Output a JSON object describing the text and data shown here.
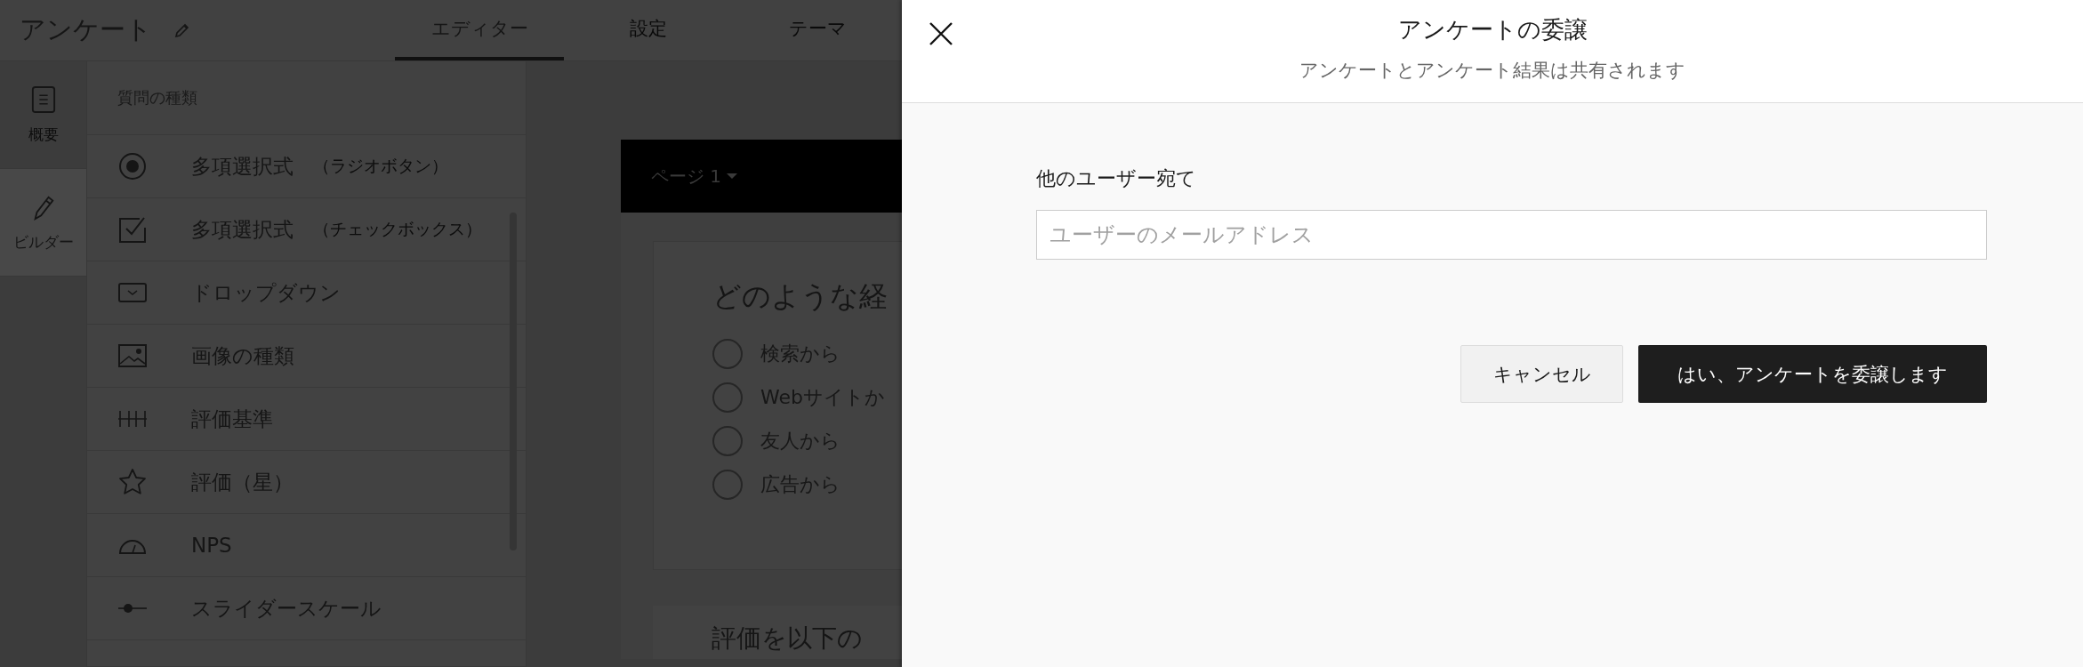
{
  "app_header": {
    "title": "アンケート",
    "tabs": [
      {
        "label": "エディター",
        "selected": true
      },
      {
        "label": "設定",
        "selected": false
      },
      {
        "label": "テーマ",
        "selected": false
      }
    ]
  },
  "side_rail": {
    "items": [
      {
        "kind": "summary",
        "label": "概要",
        "selected": false
      },
      {
        "kind": "builder",
        "label": "ビルダー",
        "selected": true
      }
    ]
  },
  "question_types": {
    "heading": "質問の種類",
    "items": [
      {
        "kind": "radio",
        "label": "多項選択式",
        "note": "（ラジオボタン）"
      },
      {
        "kind": "checkbox",
        "label": "多項選択式",
        "note": "（チェックボックス）"
      },
      {
        "kind": "dropdown",
        "label": "ドロップダウン"
      },
      {
        "kind": "image",
        "label": "画像の種類"
      },
      {
        "kind": "scale",
        "label": "評価基準"
      },
      {
        "kind": "star",
        "label": "評価（星）"
      },
      {
        "kind": "nps",
        "label": "NPS"
      },
      {
        "kind": "slider",
        "label": "スライダースケール"
      }
    ]
  },
  "page_preview": {
    "page_tab": "ページ 1",
    "question": "どのような経",
    "options": [
      {
        "label": "検索から",
        "selected": false
      },
      {
        "label": "Webサイトか",
        "selected": false
      },
      {
        "label": "友人から",
        "selected": false
      },
      {
        "label": "広告から",
        "selected": false
      }
    ],
    "next_question": "評価を以下の"
  },
  "dialog": {
    "title": "アンケートの委譲",
    "subtitle": "アンケートとアンケート結果は共有されます",
    "field_label": "他のユーザー宛て",
    "placeholder": "ユーザーのメールアドレス",
    "buttons": [
      {
        "kind": "secondary",
        "label": "キャンセル"
      },
      {
        "kind": "primary",
        "label": "はい、アンケートを委譲します"
      }
    ]
  }
}
